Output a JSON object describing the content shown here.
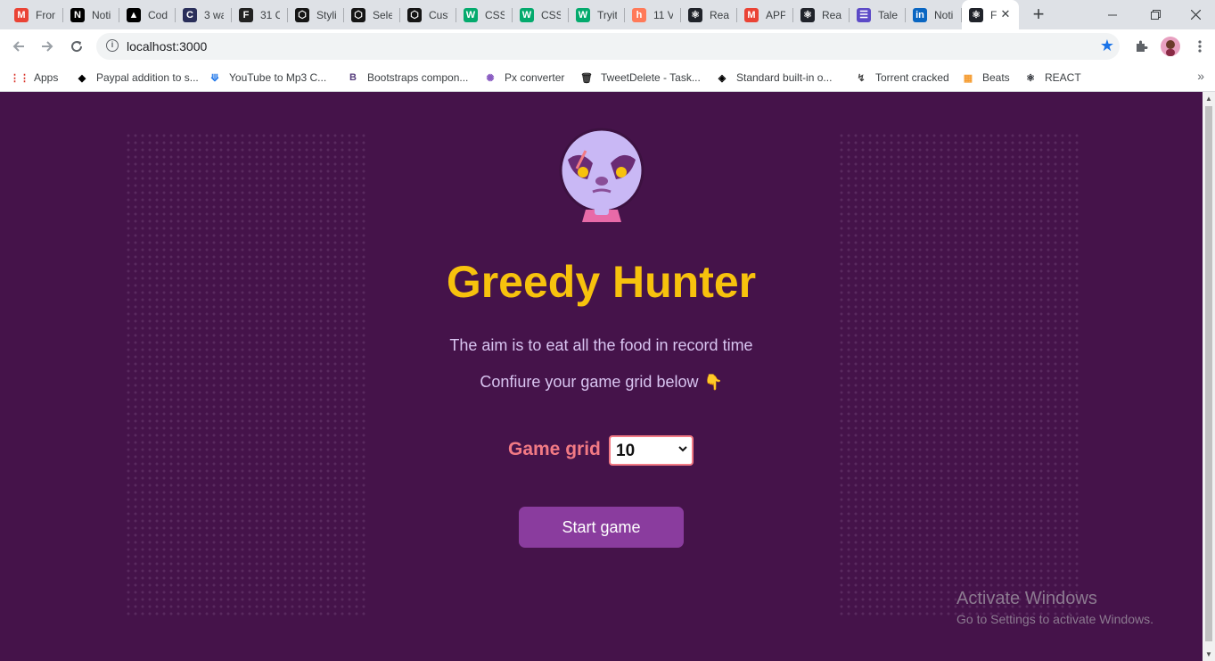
{
  "browser": {
    "tabs": [
      {
        "title": "Fron",
        "icon": "gmail-icon",
        "color": "#ea4335",
        "glyph": "M"
      },
      {
        "title": "Noti",
        "icon": "notion-icon",
        "color": "#000000",
        "glyph": "N"
      },
      {
        "title": "Cod",
        "icon": "triangle-icon",
        "color": "#000000",
        "glyph": "▲"
      },
      {
        "title": "3 wa",
        "icon": "c-icon",
        "color": "#2a2f5a",
        "glyph": "C"
      },
      {
        "title": "31 C",
        "icon": "f-icon",
        "color": "#222222",
        "glyph": "F"
      },
      {
        "title": "Styli",
        "icon": "codesandbox-icon",
        "color": "#151515",
        "glyph": "⬡"
      },
      {
        "title": "Sele",
        "icon": "codesandbox-icon",
        "color": "#151515",
        "glyph": "⬡"
      },
      {
        "title": "Cust",
        "icon": "codesandbox-icon",
        "color": "#151515",
        "glyph": "⬡"
      },
      {
        "title": "CSS",
        "icon": "w3schools-icon",
        "color": "#04aa6d",
        "glyph": "W"
      },
      {
        "title": "CSS",
        "icon": "w3schools-icon",
        "color": "#04aa6d",
        "glyph": "W"
      },
      {
        "title": "Tryit",
        "icon": "w3schools-icon",
        "color": "#04aa6d",
        "glyph": "W"
      },
      {
        "title": "11 V",
        "icon": "hashnode-icon",
        "color": "#ff7a59",
        "glyph": "h"
      },
      {
        "title": "Reac",
        "icon": "react-icon",
        "color": "#20232a",
        "glyph": "⚛"
      },
      {
        "title": "APP",
        "icon": "gmail-icon",
        "color": "#ea4335",
        "glyph": "M"
      },
      {
        "title": "Reac",
        "icon": "react-icon",
        "color": "#20232a",
        "glyph": "⚛"
      },
      {
        "title": "Tale",
        "icon": "list-icon",
        "color": "#5c4ac7",
        "glyph": "☰"
      },
      {
        "title": "Noti",
        "icon": "linkedin-icon",
        "color": "#0a66c2",
        "glyph": "in"
      },
      {
        "title": "F",
        "icon": "react-icon",
        "color": "#20232a",
        "glyph": "⚛",
        "active": true
      }
    ],
    "url": "localhost:3000",
    "bookmarks": [
      {
        "label": "Apps",
        "icon": "apps-grid-icon"
      },
      {
        "label": "Paypal addition to s...",
        "icon": "paypal-icon"
      },
      {
        "label": "YouTube to Mp3 C...",
        "icon": "download-icon"
      },
      {
        "label": "Bootstraps compon...",
        "icon": "bootstrap-icon"
      },
      {
        "label": "Px converter",
        "icon": "pinwheel-icon"
      },
      {
        "label": "TweetDelete - Task...",
        "icon": "trash-icon"
      },
      {
        "label": "Standard built-in o...",
        "icon": "mdn-icon"
      },
      {
        "label": "Torrent cracked",
        "icon": "torrent-icon"
      },
      {
        "label": "Beats",
        "icon": "beats-icon"
      },
      {
        "label": "REACT",
        "icon": "react-icon"
      }
    ]
  },
  "app": {
    "title": "Greedy Hunter",
    "line1": "The aim is to eat all the food in record time",
    "line2": "Confiure your game grid below",
    "hand_emoji": "👇",
    "grid_label": "Game grid",
    "grid_value": "10",
    "start_button": "Start game",
    "colors": {
      "background": "#45134a",
      "title": "#f7c20d",
      "text": "#d8c4f0",
      "label": "#f27a84",
      "button": "#8a3c9e"
    }
  },
  "os": {
    "watermark_title": "Activate Windows",
    "watermark_sub": "Go to Settings to activate Windows."
  }
}
